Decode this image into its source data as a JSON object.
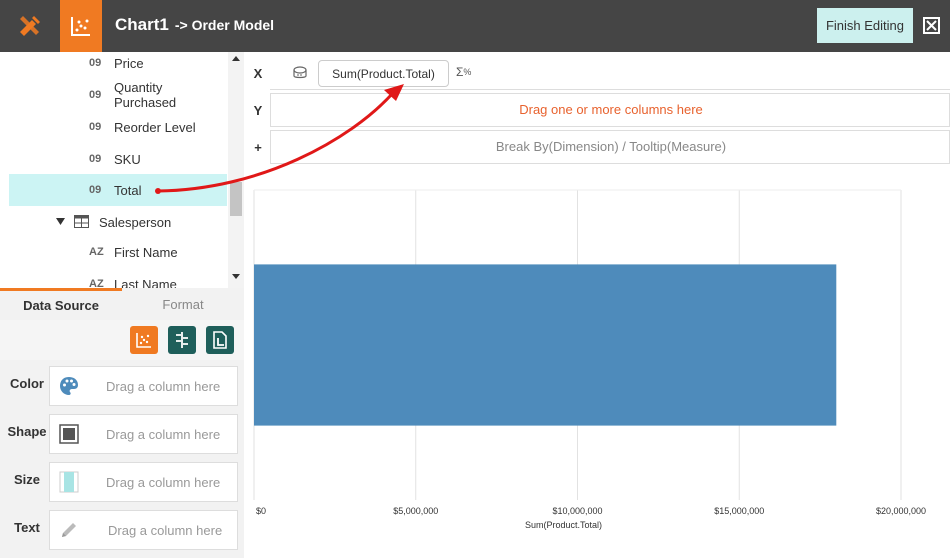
{
  "header": {
    "chart_name": "Chart1",
    "model": "-> Order Model",
    "finish_label": "Finish Editing"
  },
  "fields": [
    {
      "type": "09",
      "label": "Price"
    },
    {
      "type": "09",
      "label": "Quantity Purchased"
    },
    {
      "type": "09",
      "label": "Reorder Level"
    },
    {
      "type": "09",
      "label": "SKU"
    },
    {
      "type": "09",
      "label": "Total",
      "selected": true
    }
  ],
  "group": {
    "label": "Salesperson"
  },
  "group_fields": [
    {
      "type": "AZ",
      "label": "First Name"
    },
    {
      "type": "AZ",
      "label": "Last Name"
    }
  ],
  "tabs": {
    "data_source": "Data Source",
    "format": "Format"
  },
  "properties": [
    {
      "label": "Color",
      "placeholder": "Drag a column here",
      "icon": "palette-icon"
    },
    {
      "label": "Shape",
      "placeholder": "Drag a column here",
      "icon": "shape-icon"
    },
    {
      "label": "Size",
      "placeholder": "Drag a column here",
      "icon": "size-icon"
    },
    {
      "label": "Text",
      "placeholder": "Drag a column here",
      "icon": "pencil-icon"
    }
  ],
  "shelves": {
    "x": {
      "label": "X",
      "pill": "Sum(Product.Total)"
    },
    "y": {
      "label": "Y",
      "placeholder": "Drag one or more columns here"
    },
    "plus": {
      "label": "+",
      "placeholder": "Break By(Dimension) / Tooltip(Measure)"
    }
  },
  "colors": {
    "accent": "#f07a22",
    "topbar": "#454545",
    "teal": "#1f5f5b",
    "bar": "#4e8bbb",
    "selected": "#ccf4f4",
    "drop_text": "#e8622e",
    "arrow": "#e01818"
  },
  "chart_data": {
    "type": "bar",
    "orientation": "horizontal",
    "categories": [
      ""
    ],
    "values": [
      18000000
    ],
    "xlabel": "Sum(Product.Total)",
    "ylabel": "",
    "xlim": [
      0,
      20000000
    ],
    "xticks": [
      "$0",
      "$5,000,000",
      "$10,000,000",
      "$15,000,000",
      "$20,000,000"
    ],
    "grid": true
  }
}
